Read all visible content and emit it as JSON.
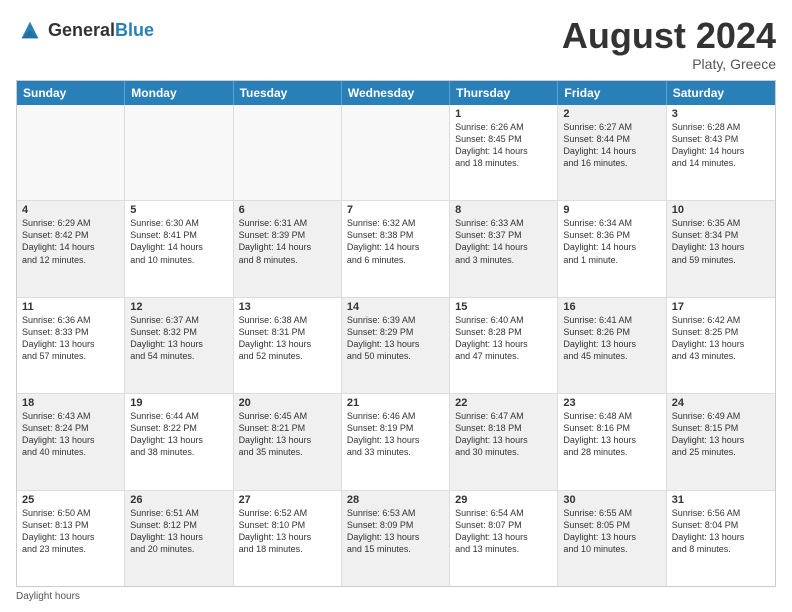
{
  "header": {
    "logo_general": "General",
    "logo_blue": "Blue",
    "title": "August 2024",
    "location": "Platy, Greece"
  },
  "days_of_week": [
    "Sunday",
    "Monday",
    "Tuesday",
    "Wednesday",
    "Thursday",
    "Friday",
    "Saturday"
  ],
  "weeks": [
    [
      {
        "day": "",
        "content": "",
        "shaded": false,
        "empty": true
      },
      {
        "day": "",
        "content": "",
        "shaded": false,
        "empty": true
      },
      {
        "day": "",
        "content": "",
        "shaded": false,
        "empty": true
      },
      {
        "day": "",
        "content": "",
        "shaded": false,
        "empty": true
      },
      {
        "day": "1",
        "content": "Sunrise: 6:26 AM\nSunset: 8:45 PM\nDaylight: 14 hours\nand 18 minutes.",
        "shaded": false,
        "empty": false
      },
      {
        "day": "2",
        "content": "Sunrise: 6:27 AM\nSunset: 8:44 PM\nDaylight: 14 hours\nand 16 minutes.",
        "shaded": true,
        "empty": false
      },
      {
        "day": "3",
        "content": "Sunrise: 6:28 AM\nSunset: 8:43 PM\nDaylight: 14 hours\nand 14 minutes.",
        "shaded": false,
        "empty": false
      }
    ],
    [
      {
        "day": "4",
        "content": "Sunrise: 6:29 AM\nSunset: 8:42 PM\nDaylight: 14 hours\nand 12 minutes.",
        "shaded": true,
        "empty": false
      },
      {
        "day": "5",
        "content": "Sunrise: 6:30 AM\nSunset: 8:41 PM\nDaylight: 14 hours\nand 10 minutes.",
        "shaded": false,
        "empty": false
      },
      {
        "day": "6",
        "content": "Sunrise: 6:31 AM\nSunset: 8:39 PM\nDaylight: 14 hours\nand 8 minutes.",
        "shaded": true,
        "empty": false
      },
      {
        "day": "7",
        "content": "Sunrise: 6:32 AM\nSunset: 8:38 PM\nDaylight: 14 hours\nand 6 minutes.",
        "shaded": false,
        "empty": false
      },
      {
        "day": "8",
        "content": "Sunrise: 6:33 AM\nSunset: 8:37 PM\nDaylight: 14 hours\nand 3 minutes.",
        "shaded": true,
        "empty": false
      },
      {
        "day": "9",
        "content": "Sunrise: 6:34 AM\nSunset: 8:36 PM\nDaylight: 14 hours\nand 1 minute.",
        "shaded": false,
        "empty": false
      },
      {
        "day": "10",
        "content": "Sunrise: 6:35 AM\nSunset: 8:34 PM\nDaylight: 13 hours\nand 59 minutes.",
        "shaded": true,
        "empty": false
      }
    ],
    [
      {
        "day": "11",
        "content": "Sunrise: 6:36 AM\nSunset: 8:33 PM\nDaylight: 13 hours\nand 57 minutes.",
        "shaded": false,
        "empty": false
      },
      {
        "day": "12",
        "content": "Sunrise: 6:37 AM\nSunset: 8:32 PM\nDaylight: 13 hours\nand 54 minutes.",
        "shaded": true,
        "empty": false
      },
      {
        "day": "13",
        "content": "Sunrise: 6:38 AM\nSunset: 8:31 PM\nDaylight: 13 hours\nand 52 minutes.",
        "shaded": false,
        "empty": false
      },
      {
        "day": "14",
        "content": "Sunrise: 6:39 AM\nSunset: 8:29 PM\nDaylight: 13 hours\nand 50 minutes.",
        "shaded": true,
        "empty": false
      },
      {
        "day": "15",
        "content": "Sunrise: 6:40 AM\nSunset: 8:28 PM\nDaylight: 13 hours\nand 47 minutes.",
        "shaded": false,
        "empty": false
      },
      {
        "day": "16",
        "content": "Sunrise: 6:41 AM\nSunset: 8:26 PM\nDaylight: 13 hours\nand 45 minutes.",
        "shaded": true,
        "empty": false
      },
      {
        "day": "17",
        "content": "Sunrise: 6:42 AM\nSunset: 8:25 PM\nDaylight: 13 hours\nand 43 minutes.",
        "shaded": false,
        "empty": false
      }
    ],
    [
      {
        "day": "18",
        "content": "Sunrise: 6:43 AM\nSunset: 8:24 PM\nDaylight: 13 hours\nand 40 minutes.",
        "shaded": true,
        "empty": false
      },
      {
        "day": "19",
        "content": "Sunrise: 6:44 AM\nSunset: 8:22 PM\nDaylight: 13 hours\nand 38 minutes.",
        "shaded": false,
        "empty": false
      },
      {
        "day": "20",
        "content": "Sunrise: 6:45 AM\nSunset: 8:21 PM\nDaylight: 13 hours\nand 35 minutes.",
        "shaded": true,
        "empty": false
      },
      {
        "day": "21",
        "content": "Sunrise: 6:46 AM\nSunset: 8:19 PM\nDaylight: 13 hours\nand 33 minutes.",
        "shaded": false,
        "empty": false
      },
      {
        "day": "22",
        "content": "Sunrise: 6:47 AM\nSunset: 8:18 PM\nDaylight: 13 hours\nand 30 minutes.",
        "shaded": true,
        "empty": false
      },
      {
        "day": "23",
        "content": "Sunrise: 6:48 AM\nSunset: 8:16 PM\nDaylight: 13 hours\nand 28 minutes.",
        "shaded": false,
        "empty": false
      },
      {
        "day": "24",
        "content": "Sunrise: 6:49 AM\nSunset: 8:15 PM\nDaylight: 13 hours\nand 25 minutes.",
        "shaded": true,
        "empty": false
      }
    ],
    [
      {
        "day": "25",
        "content": "Sunrise: 6:50 AM\nSunset: 8:13 PM\nDaylight: 13 hours\nand 23 minutes.",
        "shaded": false,
        "empty": false
      },
      {
        "day": "26",
        "content": "Sunrise: 6:51 AM\nSunset: 8:12 PM\nDaylight: 13 hours\nand 20 minutes.",
        "shaded": true,
        "empty": false
      },
      {
        "day": "27",
        "content": "Sunrise: 6:52 AM\nSunset: 8:10 PM\nDaylight: 13 hours\nand 18 minutes.",
        "shaded": false,
        "empty": false
      },
      {
        "day": "28",
        "content": "Sunrise: 6:53 AM\nSunset: 8:09 PM\nDaylight: 13 hours\nand 15 minutes.",
        "shaded": true,
        "empty": false
      },
      {
        "day": "29",
        "content": "Sunrise: 6:54 AM\nSunset: 8:07 PM\nDaylight: 13 hours\nand 13 minutes.",
        "shaded": false,
        "empty": false
      },
      {
        "day": "30",
        "content": "Sunrise: 6:55 AM\nSunset: 8:05 PM\nDaylight: 13 hours\nand 10 minutes.",
        "shaded": true,
        "empty": false
      },
      {
        "day": "31",
        "content": "Sunrise: 6:56 AM\nSunset: 8:04 PM\nDaylight: 13 hours\nand 8 minutes.",
        "shaded": false,
        "empty": false
      }
    ]
  ],
  "footer": {
    "daylight_label": "Daylight hours"
  }
}
